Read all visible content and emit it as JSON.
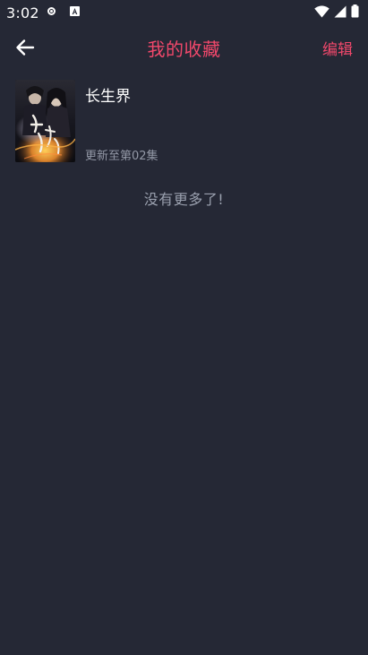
{
  "status_bar": {
    "time": "3:02",
    "icons": [
      "record-icon",
      "a-app-icon",
      "wifi-icon",
      "cell-signal-icon",
      "battery-icon"
    ]
  },
  "app_bar": {
    "back_icon": "arrow-left-icon",
    "title": "我的收藏",
    "edit_label": "编辑"
  },
  "favorites": [
    {
      "title": "长生界",
      "update_text": "更新至第02集"
    }
  ],
  "list_end_text": "没有更多了!",
  "colors": {
    "background": "#252835",
    "accent": "#f1486b",
    "secondary_text": "#9398a6",
    "primary_text": "#ffffff"
  }
}
